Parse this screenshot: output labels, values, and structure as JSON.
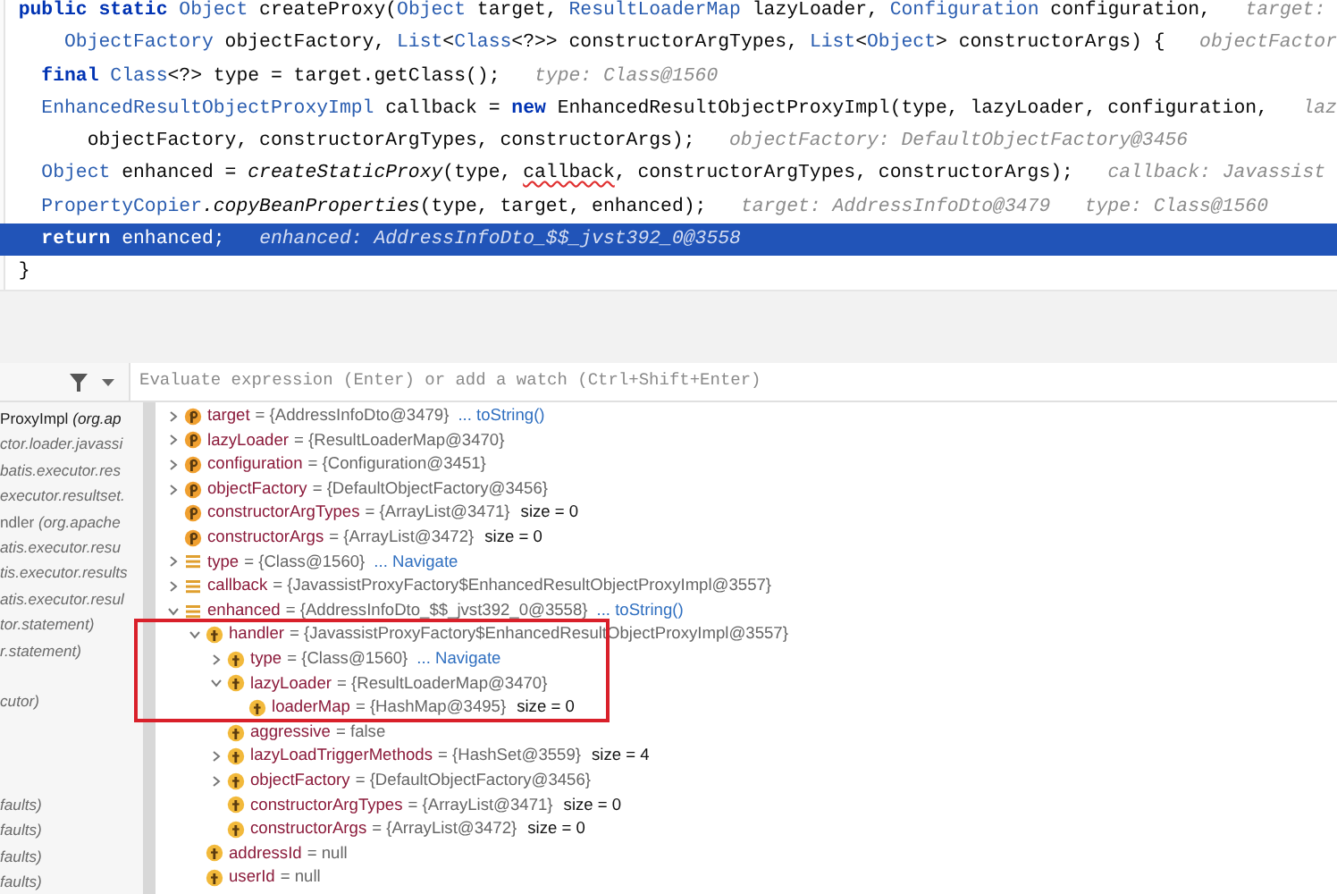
{
  "code_lines": [
    {
      "selected": false,
      "tokens": [
        {
          "kind": "kw",
          "text": "public static "
        },
        {
          "kind": "type",
          "text": "Object"
        },
        {
          "kind": "plain",
          "text": " createProxy("
        },
        {
          "kind": "type",
          "text": "Object"
        },
        {
          "kind": "plain",
          "text": " target, "
        },
        {
          "kind": "type",
          "text": "ResultLoaderMap"
        },
        {
          "kind": "plain",
          "text": " lazyLoader, "
        },
        {
          "kind": "type",
          "text": "Configuration"
        },
        {
          "kind": "plain",
          "text": " configuration,"
        },
        {
          "kind": "hint",
          "text": "target:"
        }
      ]
    },
    {
      "selected": false,
      "tokens": [
        {
          "kind": "type",
          "text": "    ObjectFactory"
        },
        {
          "kind": "plain",
          "text": " objectFactory, "
        },
        {
          "kind": "type",
          "text": "List"
        },
        {
          "kind": "plain",
          "text": "<"
        },
        {
          "kind": "type",
          "text": "Class"
        },
        {
          "kind": "plain",
          "text": "<?>> constructorArgTypes, "
        },
        {
          "kind": "type",
          "text": "List"
        },
        {
          "kind": "plain",
          "text": "<"
        },
        {
          "kind": "type",
          "text": "Object"
        },
        {
          "kind": "plain",
          "text": "> constructorArgs) {"
        },
        {
          "kind": "hint",
          "text": "objectFactor"
        }
      ]
    },
    {
      "selected": false,
      "tokens": [
        {
          "kind": "kw",
          "text": "  final "
        },
        {
          "kind": "type",
          "text": "Class"
        },
        {
          "kind": "plain",
          "text": "<?> type = target.getClass();"
        },
        {
          "kind": "hint",
          "text": "type: Class@1560"
        }
      ]
    },
    {
      "selected": false,
      "tokens": [
        {
          "kind": "type",
          "text": "  EnhancedResultObjectProxyImpl"
        },
        {
          "kind": "plain",
          "text": " callback = "
        },
        {
          "kind": "kw",
          "text": "new"
        },
        {
          "kind": "plain",
          "text": " EnhancedResultObjectProxyImpl(type, lazyLoader, configuration,"
        },
        {
          "kind": "hint",
          "text": "laz"
        }
      ]
    },
    {
      "selected": false,
      "tokens": [
        {
          "kind": "plain",
          "text": "      objectFactory, constructorArgTypes, constructorArgs);"
        },
        {
          "kind": "hint",
          "text": "objectFactory: DefaultObjectFactory@3456"
        }
      ]
    },
    {
      "selected": false,
      "tokens": [
        {
          "kind": "type",
          "text": "  Object"
        },
        {
          "kind": "plain",
          "text": " enhanced = "
        },
        {
          "kind": "call",
          "text": "createStaticProxy"
        },
        {
          "kind": "plain",
          "text": "(type, "
        },
        {
          "kind": "warn",
          "text": "callback"
        },
        {
          "kind": "plain",
          "text": ", constructorArgTypes, constructorArgs);"
        },
        {
          "kind": "hint",
          "text": "callback: Javassist"
        }
      ]
    },
    {
      "selected": false,
      "tokens": [
        {
          "kind": "type",
          "text": "  PropertyCopier"
        },
        {
          "kind": "call",
          "text": ".copyBeanProperties"
        },
        {
          "kind": "plain",
          "text": "(type, target, enhanced);"
        },
        {
          "kind": "hint",
          "text": "target: AddressInfoDto@3479"
        },
        {
          "kind": "hint",
          "text": "type: Class@1560"
        }
      ]
    },
    {
      "selected": true,
      "tokens": [
        {
          "kind": "kw",
          "text": "  return"
        },
        {
          "kind": "plain",
          "text": " enhanced;"
        },
        {
          "kind": "hint",
          "text": "enhanced: AddressInfoDto_$$_jvst392_0@3558"
        }
      ]
    },
    {
      "selected": false,
      "tokens": [
        {
          "kind": "plain",
          "text": "}"
        }
      ]
    }
  ],
  "evaluate_field": {
    "placeholder": "Evaluate expression (Enter) or add a watch (Ctrl+Shift+Enter)"
  },
  "frames": [
    {
      "kind": "frame",
      "text": "ProxyImpl *(org.ap*"
    },
    {
      "kind": "frame",
      "text": "*ctor.loader.javassi*"
    },
    {
      "kind": "frame",
      "text": "*batis.executor.res*"
    },
    {
      "kind": "frame",
      "text": "*executor.resultset.*"
    },
    {
      "kind": "frame",
      "text": "ndler *(org.apache*"
    },
    {
      "kind": "frame",
      "text": "*atis.executor.resu*"
    },
    {
      "kind": "frame",
      "text": "*tis.executor.results*"
    },
    {
      "kind": "frame",
      "text": "*atis.executor.resul*"
    },
    {
      "kind": "frame",
      "text": "*tor.statement)*"
    },
    {
      "kind": "frame",
      "text": "*r.statement)*"
    },
    {
      "kind": "blank"
    },
    {
      "kind": "frame",
      "text": "*cutor)*"
    },
    {
      "kind": "blank"
    },
    {
      "kind": "blank"
    },
    {
      "kind": "blank"
    },
    {
      "kind": "frame",
      "text": "*faults)*"
    },
    {
      "kind": "frame",
      "text": "*faults)*"
    },
    {
      "kind": "frame",
      "text": "*faults)*"
    },
    {
      "kind": "frame",
      "text": "*faults)*"
    }
  ],
  "variables": [
    {
      "kind": "param",
      "name": "target",
      "value": "= {AddressInfoDto@3479}",
      "link": "... toString()",
      "expanded": false
    },
    {
      "kind": "param",
      "name": "lazyLoader",
      "value": "= {ResultLoaderMap@3470}",
      "expanded": false
    },
    {
      "kind": "param",
      "name": "configuration",
      "value": "= {Configuration@3451}",
      "expanded": false
    },
    {
      "kind": "param",
      "name": "objectFactory",
      "value": "= {DefaultObjectFactory@3456}",
      "expanded": false
    },
    {
      "kind": "param",
      "name": "constructorArgTypes",
      "value": "= {ArrayList@3471}",
      "extra": "size = 0"
    },
    {
      "kind": "param",
      "name": "constructorArgs",
      "value": "= {ArrayList@3472}",
      "extra": "size = 0"
    },
    {
      "kind": "local",
      "name": "type",
      "value": "= {Class@1560}",
      "link": "... Navigate",
      "expanded": false
    },
    {
      "kind": "local",
      "name": "callback",
      "value": "= {JavassistProxyFactory$EnhancedResultObjectProxyImpl@3557}",
      "expanded": false
    },
    {
      "kind": "local",
      "name": "enhanced",
      "value": "= {AddressInfoDto_$$_jvst392_0@3558}",
      "link": "... toString()",
      "expanded": true,
      "children": [
        {
          "kind": "field",
          "name": "handler",
          "value": "= {JavassistProxyFactory$EnhancedResultObjectProxyImpl@3557}",
          "expanded": true,
          "boxed": true,
          "children": [
            {
              "kind": "field",
              "name": "type",
              "value": "= {Class@1560}",
              "link": "... Navigate",
              "expanded": false,
              "boxed": true
            },
            {
              "kind": "field",
              "name": "lazyLoader",
              "value": "= {ResultLoaderMap@3470}",
              "expanded": true,
              "boxed": true,
              "children": [
                {
                  "kind": "field",
                  "name": "loaderMap",
                  "value": "= {HashMap@3495}",
                  "extra": "size = 0",
                  "boxed": true
                }
              ]
            },
            {
              "kind": "field",
              "name": "aggressive",
              "value": "= false"
            },
            {
              "kind": "field",
              "name": "lazyLoadTriggerMethods",
              "value": "= {HashSet@3559}",
              "extra": "size = 4",
              "expanded": false
            },
            {
              "kind": "field",
              "name": "objectFactory",
              "value": "= {DefaultObjectFactory@3456}",
              "expanded": false
            },
            {
              "kind": "field",
              "name": "constructorArgTypes",
              "value": "= {ArrayList@3471}",
              "extra": "size = 0"
            },
            {
              "kind": "field",
              "name": "constructorArgs",
              "value": "= {ArrayList@3472}",
              "extra": "size = 0"
            }
          ]
        },
        {
          "kind": "field",
          "name": "addressId",
          "value": "= null"
        },
        {
          "kind": "field",
          "name": "userId",
          "value": "= null"
        }
      ]
    }
  ]
}
